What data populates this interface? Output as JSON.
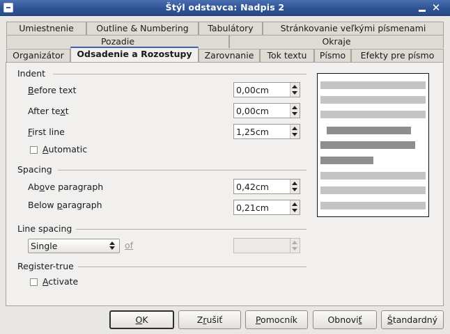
{
  "window": {
    "title": "Štýl odstavca: Nadpis 2",
    "close_glyph": "✕"
  },
  "tabs": {
    "row1": [
      "Umiestnenie",
      "Outline & Numbering",
      "Tabulátory",
      "Stránkovanie veľkými písmenami"
    ],
    "row2": [
      "Pozadie",
      "Okraje"
    ],
    "row3": [
      "Organizátor",
      "Odsadenie a Rozostupy",
      "Zarovnanie",
      "Tok textu",
      "Písmo",
      "Efekty pre písmo"
    ],
    "active": "Odsadenie a Rozostupy"
  },
  "indent": {
    "title": "Indent",
    "before_text": {
      "mnemonic": "B",
      "rest": "efore text",
      "value": "0,00cm"
    },
    "after_text": {
      "pre": "After te",
      "mnemonic": "x",
      "post": "t",
      "value": "0,00cm"
    },
    "first_line": {
      "mnemonic": "F",
      "rest": "irst line",
      "value": "1,25cm"
    },
    "automatic": {
      "mnemonic": "A",
      "rest": "utomatic",
      "checked": false
    }
  },
  "spacing": {
    "title": "Spacing",
    "above": {
      "pre": "Ab",
      "mnemonic": "o",
      "post": "ve paragraph",
      "value": "0,42cm"
    },
    "below": {
      "pre": "Below ",
      "mnemonic": "p",
      "post": "aragraph",
      "value": "0,21cm"
    }
  },
  "line_spacing": {
    "title": "Line spacing",
    "selected": "Single",
    "of_label": "of",
    "value": ""
  },
  "register_true": {
    "title": "Register-true",
    "activate": {
      "mnemonic": "A",
      "rest": "ctivate",
      "checked": false
    }
  },
  "buttons": {
    "ok": {
      "mnemonic": "O",
      "rest": "K"
    },
    "cancel": {
      "pre": "Z",
      "mnemonic": "r",
      "post": "ušiť"
    },
    "help": {
      "mnemonic": "P",
      "rest": "omocník"
    },
    "reset": {
      "pre": "Obnovi",
      "mnemonic": "ť",
      "post": ""
    },
    "standard": {
      "mnemonic": "Š",
      "rest": "tandardný"
    }
  },
  "colors": {
    "titlebar": "#2f5394",
    "active_tab_accent": "#3a63ae",
    "preview_light": "#c4c4c4",
    "preview_dark": "#8e8e8e"
  }
}
